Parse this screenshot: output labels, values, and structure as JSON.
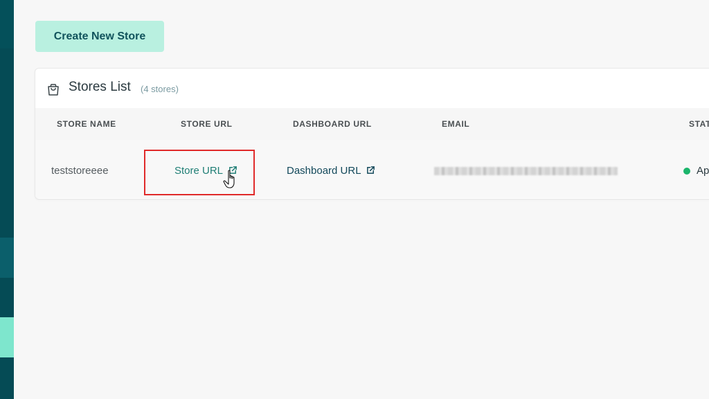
{
  "actions": {
    "create_store_label": "Create New Store"
  },
  "stores_card": {
    "icon": "shopping-bag-icon",
    "title": "Stores List",
    "count_label": "(4 stores)"
  },
  "table": {
    "columns": [
      "STORE NAME",
      "STORE URL",
      "DASHBOARD URL",
      "EMAIL",
      "STAT"
    ],
    "rows": [
      {
        "store_name": "teststoreeee",
        "store_url_label": "Store URL",
        "dashboard_url_label": "Dashboard URL",
        "email": "",
        "status": "Ap",
        "status_color": "#1bb56b"
      }
    ]
  },
  "colors": {
    "sidebar": "#054b55",
    "accent": "#b9f0e0",
    "link": "#1f7e75",
    "highlight": "#e02a2a"
  }
}
